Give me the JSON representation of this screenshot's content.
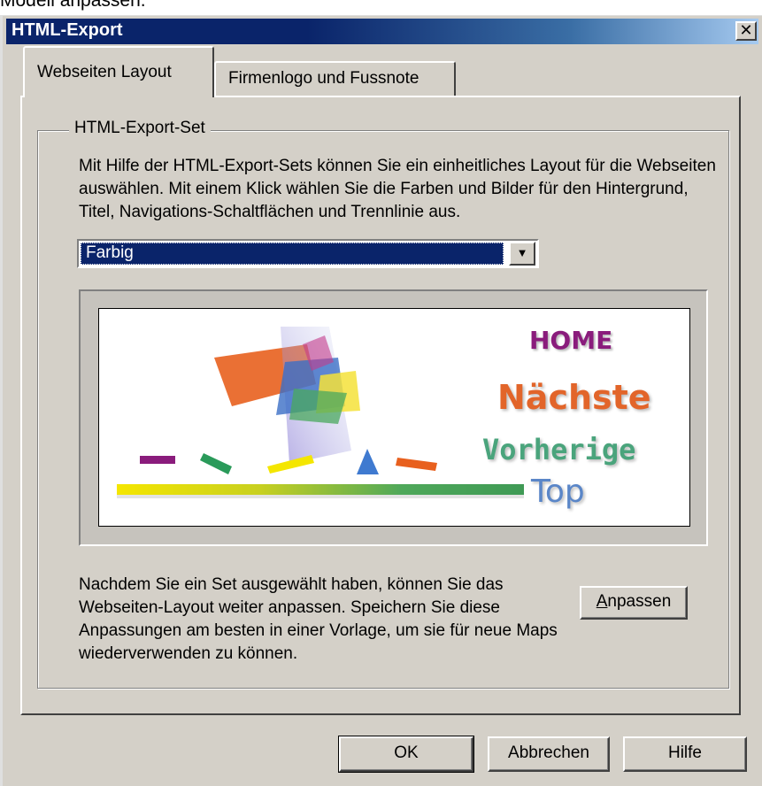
{
  "caption_fragment": "Modell anpassen.",
  "window": {
    "title": "HTML-Export",
    "close_glyph": "✕"
  },
  "tabs": [
    {
      "label": "Webseiten Layout",
      "active": true
    },
    {
      "label": "Firmenlogo und Fussnote",
      "active": false
    }
  ],
  "group": {
    "legend": "HTML-Export-Set",
    "description": "Mit Hilfe der HTML-Export-Sets können Sie ein einheitliches Layout für die Webseiten auswählen. Mit einem Klick wählen Sie die Farben und Bilder für den Hintergrund, Titel, Navigations-Schaltflächen und Trennlinie aus.",
    "select_value": "Farbig",
    "preview": {
      "home": "HOME",
      "next": "Nächste",
      "prev": "Vorherige",
      "top": "Top"
    },
    "note": "Nachdem Sie ein Set ausgewählt haben, können Sie das Webseiten-Layout weiter anpassen. Speichern Sie diese Anpassungen am besten in einer Vorlage, um sie für neue Maps wiederverwenden zu können.",
    "adjust_button": {
      "mnemonic": "A",
      "rest": "npassen"
    }
  },
  "buttons": {
    "ok": "OK",
    "cancel": "Abbrechen",
    "help": "Hilfe"
  },
  "icons": {
    "dropdown": "arrow-down-icon",
    "close": "close-icon"
  },
  "colors": {
    "titlebar": "#0a246a",
    "selection": "#0a246a",
    "dialog_face": "#d4d0c8"
  }
}
